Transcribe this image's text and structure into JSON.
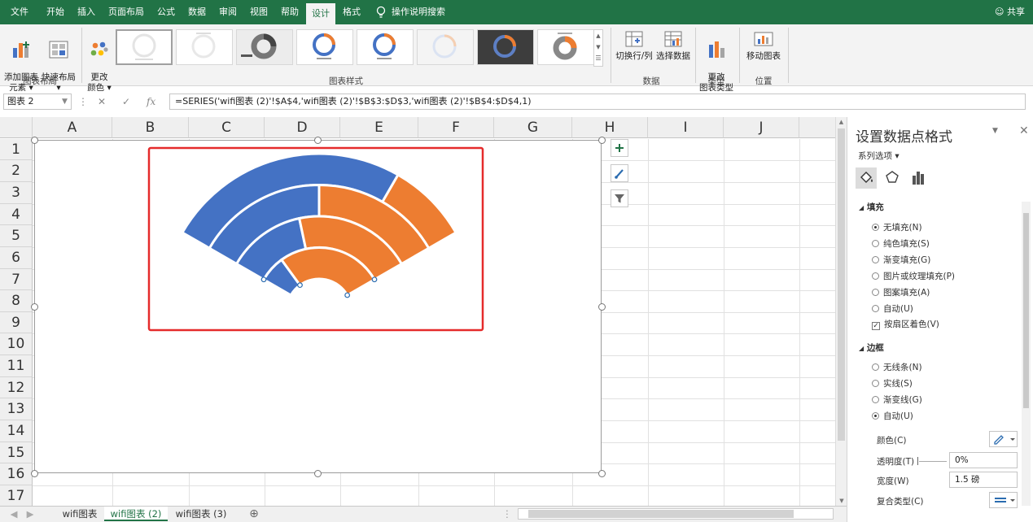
{
  "ribbon_tabs": [
    "文件",
    "开始",
    "插入",
    "页面布局",
    "公式",
    "数据",
    "审阅",
    "视图",
    "帮助",
    "设计",
    "格式",
    "操作说明搜索"
  ],
  "share_label": "共享",
  "ribbon": {
    "add_element": "添加图表\n元素 ▾",
    "quick_layout": "快速布局\n▾",
    "change_colors": "更改\n颜色 ▾",
    "switch_row_col": "切换行/列",
    "select_data": "选择数据",
    "change_type": "更改\n图表类型",
    "move_chart": "移动图表",
    "group_layouts": "图表布局",
    "group_styles": "图表样式",
    "group_data": "数据",
    "group_type": "类型",
    "group_location": "位置"
  },
  "formula_bar": {
    "name_box": "图表 2",
    "formula": "=SERIES('wifi图表 (2)'!$A$4,'wifi图表 (2)'!$B$3:$D$3,'wifi图表 (2)'!$B$4:$D$4,1)"
  },
  "columns": [
    "A",
    "B",
    "C",
    "D",
    "E",
    "F",
    "G",
    "H",
    "I",
    "J"
  ],
  "rows": [
    "1",
    "2",
    "3",
    "4",
    "5",
    "6",
    "7",
    "8",
    "9",
    "10",
    "11",
    "12",
    "13",
    "14",
    "15",
    "16",
    "17"
  ],
  "sheet_tabs": [
    "wifi图表",
    "wifi图表 (2)",
    "wifi图表 (3)"
  ],
  "pane": {
    "title": "设置数据点格式",
    "series_options": "系列选项 ▾",
    "fill_header": "填充",
    "fill_options": [
      "无填充(N)",
      "纯色填充(S)",
      "渐变填充(G)",
      "图片或纹理填充(P)",
      "图案填充(A)",
      "自动(U)"
    ],
    "vary_colors": "按扇区着色(V)",
    "border_header": "边框",
    "border_options": [
      "无线条(N)",
      "实线(S)",
      "渐变线(G)",
      "自动(U)"
    ],
    "color_label": "颜色(C)",
    "transparency_label": "透明度(T)",
    "transparency_value": "0%",
    "width_label": "宽度(W)",
    "width_value": "1.5 磅",
    "compound_label": "复合类型(C)"
  },
  "colors": {
    "excel_green": "#217346",
    "blue": "#4472C4",
    "orange": "#ED7D31",
    "highlight": "#E52B2B"
  },
  "chart_data": {
    "type": "doughnut",
    "description_free": true,
    "rings": [
      {
        "values": [
          75,
          25
        ],
        "colors": [
          "#4472C4",
          "#ED7D31"
        ]
      },
      {
        "values": [
          50,
          50
        ],
        "colors": [
          "#4472C4",
          "#ED7D31"
        ]
      },
      {
        "values": [
          40,
          60
        ],
        "colors": [
          "#4472C4",
          "#ED7D31"
        ]
      },
      {
        "values": [
          20,
          80
        ],
        "colors": [
          "#4472C4",
          "#ED7D31"
        ]
      }
    ],
    "visible_angle_range_deg": [
      -60,
      60
    ]
  }
}
